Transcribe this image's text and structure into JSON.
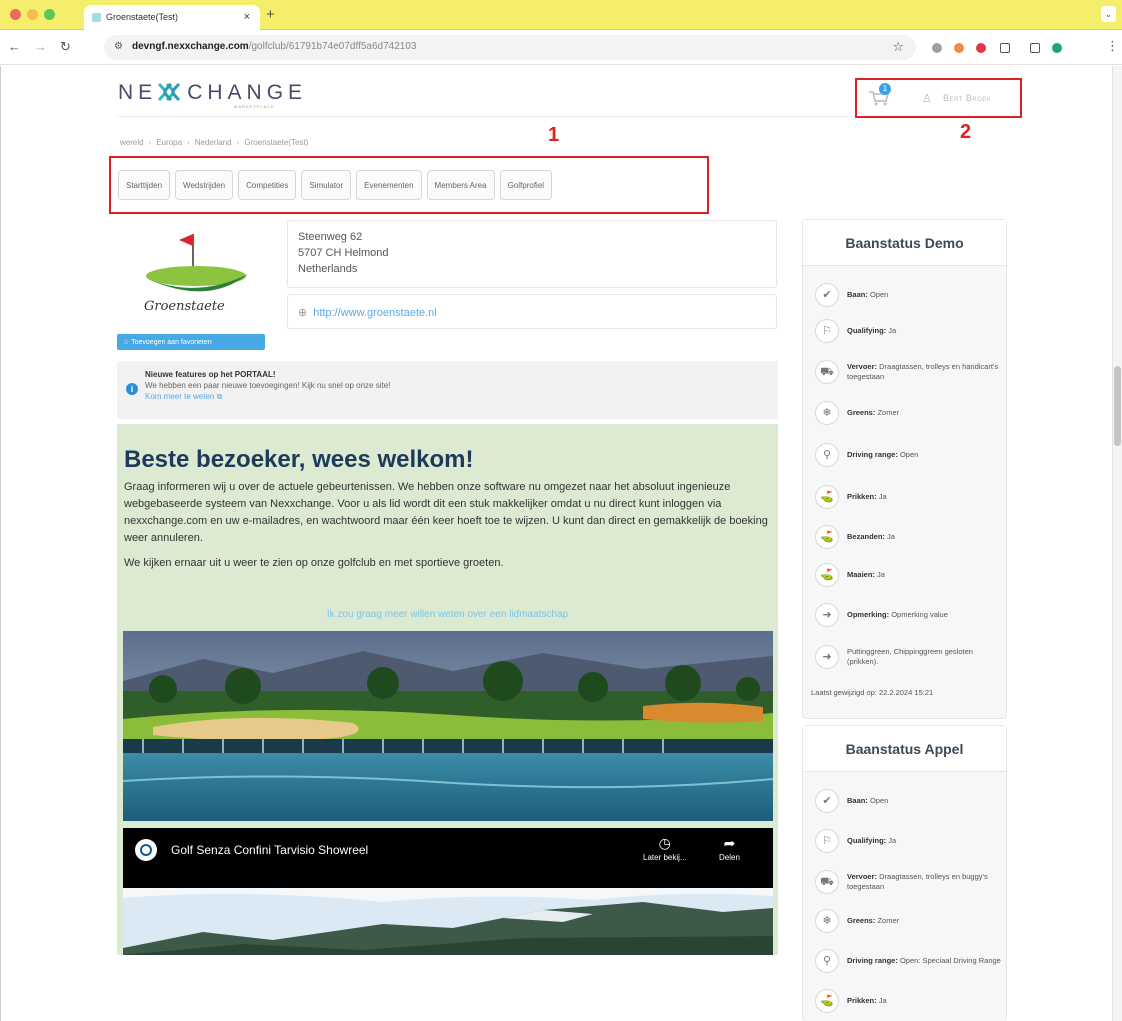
{
  "browser": {
    "tab_title": "Groenstaete(Test)",
    "close_glyph": "×",
    "new_tab_glyph": "+",
    "url_host": "devngf.nexxchange.com",
    "url_path": "/golfclub/61791b74e07dff5a6d742103",
    "icons": [
      "back-arrow-icon",
      "forward-arrow-icon",
      "reload-icon",
      "site-settings-icon",
      "star-icon"
    ],
    "colors": {
      "tab_strip": "#f5ee6a",
      "traffic_red": "#ee6a5e",
      "traffic_yellow": "#f5bd4f",
      "traffic_green": "#61c454"
    }
  },
  "header": {
    "logo_left": "NE",
    "logo_right": "CHANGE",
    "logo_sub": "MARKETPLACE",
    "cart_count": "1",
    "user_name": "Bert Broek"
  },
  "annotations": {
    "box1": "1",
    "box2": "2",
    "color": "#e02020"
  },
  "breadcrumb": [
    "wereld",
    "Europa",
    "Nederland",
    "Groenstaete(Test)"
  ],
  "tabs": [
    "Starttijden",
    "Wedstrijden",
    "Competities",
    "Simulator",
    "Evenementen",
    "Members Area",
    "Golfprofiel"
  ],
  "club": {
    "logo_text": "Groenstaete",
    "favorite_button": "Toevoegen aan favorieten",
    "address": [
      "Steenweg 62",
      "5707 CH Helmond",
      "Netherlands"
    ],
    "website": "http://www.groenstaete.nl"
  },
  "notice": {
    "title": "Nieuwe features op het PORTAAL!",
    "text": "We hebben een paar nieuwe toevoegingen! Kijk nu snel op onze site!",
    "more": "Kom meer te weten"
  },
  "welcome": {
    "heading": "Beste bezoeker, wees welkom!",
    "para1": "Graag informeren wij u over de actuele gebeurtenissen. We hebben onze software nu omgezet naar het absoluut ingenieuze webgebaseerde systeem van Nexxchange. Voor u als lid wordt dit een stuk makkelijker omdat u nu direct kunt inloggen via nexxchange.com en uw e-mailadres, en wachtwoord maar één keer hoeft toe te wijzen. U kunt dan direct en gemakkelijk de boeking weer annuleren.",
    "para2": "We kijken ernaar uit u weer te zien op onze golfclub en met sportieve groeten.",
    "member_link": "Ik zou graag meer willen weten over een lidmaatschap"
  },
  "video": {
    "title": "Golf Senza Confini Tarvisio Showreel",
    "watch_later": "Later bekij...",
    "share": "Delen"
  },
  "status_demo": {
    "title": "Baanstatus Demo",
    "rows": [
      {
        "icon": "checkmark-icon",
        "glyph": "✔",
        "label": "Baan:",
        "value": "Open"
      },
      {
        "icon": "flag-icon",
        "glyph": "⚐",
        "label": "Qualifying:",
        "value": "Ja"
      },
      {
        "icon": "golf-cart-icon",
        "glyph": "⛟",
        "label": "Vervoer:",
        "value": "Draagtassen, trolleys en handicart's toegestaan"
      },
      {
        "icon": "snowflake-icon",
        "glyph": "❄",
        "label": "Greens:",
        "value": "Zomer"
      },
      {
        "icon": "driving-range-icon",
        "glyph": "⚲",
        "label": "Driving range:",
        "value": "Open"
      },
      {
        "icon": "golfer-icon",
        "glyph": "⛳",
        "label": "Prikken:",
        "value": "Ja"
      },
      {
        "icon": "golfer-icon",
        "glyph": "⛳",
        "label": "Bezanden:",
        "value": "Ja"
      },
      {
        "icon": "golfer-icon",
        "glyph": "⛳",
        "label": "Maaien:",
        "value": "Ja"
      },
      {
        "icon": "arrow-right-icon",
        "glyph": "➜",
        "label": "Opmerking:",
        "value": "Opmerking value"
      },
      {
        "icon": "arrow-right-icon",
        "glyph": "➜",
        "label": "",
        "value": "Puttinggreen, Chippinggreen gesloten (prikken)."
      }
    ],
    "updated": "Laatst gewijzigd op: 22.2.2024 15:21"
  },
  "status_appel": {
    "title": "Baanstatus Appel",
    "rows": [
      {
        "icon": "checkmark-icon",
        "glyph": "✔",
        "label": "Baan:",
        "value": "Open"
      },
      {
        "icon": "flag-icon",
        "glyph": "⚐",
        "label": "Qualifying:",
        "value": "Ja"
      },
      {
        "icon": "golf-cart-icon",
        "glyph": "⛟",
        "label": "Vervoer:",
        "value": "Draagtassen, trolleys en buggy's toegestaan"
      },
      {
        "icon": "snowflake-icon",
        "glyph": "❄",
        "label": "Greens:",
        "value": "Zomer"
      },
      {
        "icon": "driving-range-icon",
        "glyph": "⚲",
        "label": "Driving range:",
        "value": "Open: Speciaal Driving Range"
      },
      {
        "icon": "golfer-icon",
        "glyph": "⛳",
        "label": "Prikken:",
        "value": "Ja"
      }
    ]
  }
}
